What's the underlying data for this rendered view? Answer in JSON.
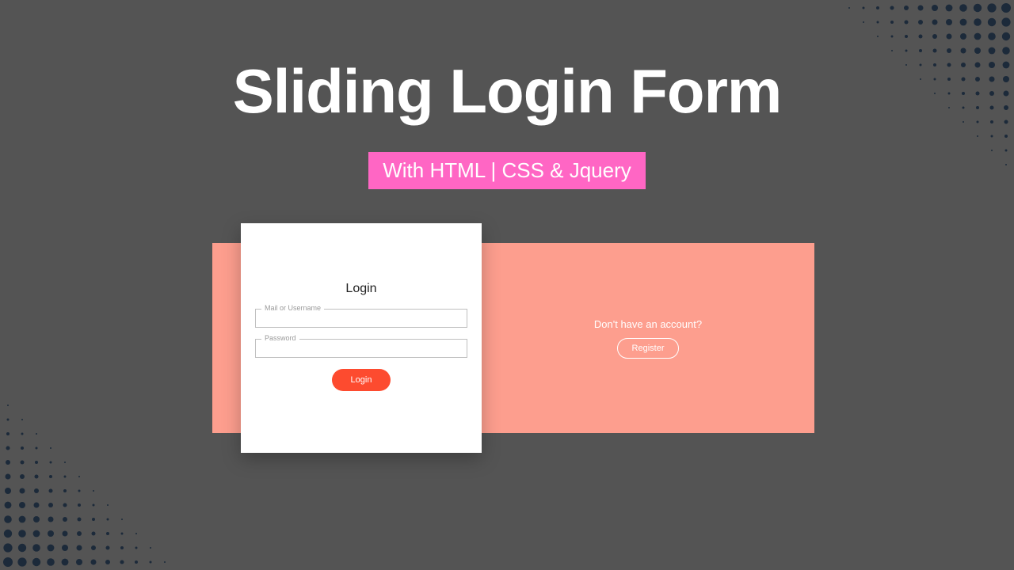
{
  "hero": {
    "title": "Sliding Login Form",
    "subtitle": "With HTML | CSS & Jquery"
  },
  "card": {
    "title": "Login",
    "username_label": "Mail or Username",
    "username_value": "",
    "password_label": "Password",
    "password_value": "",
    "login_button": "Login"
  },
  "panel": {
    "prompt": "Don't have an account?",
    "register_button": "Register"
  },
  "colors": {
    "background": "#545454",
    "accent_pink": "#ff66c4",
    "panel_salmon": "#fd9e8e",
    "button_orange": "#fd4b2f",
    "dot_navy": "#1c2a3a"
  }
}
